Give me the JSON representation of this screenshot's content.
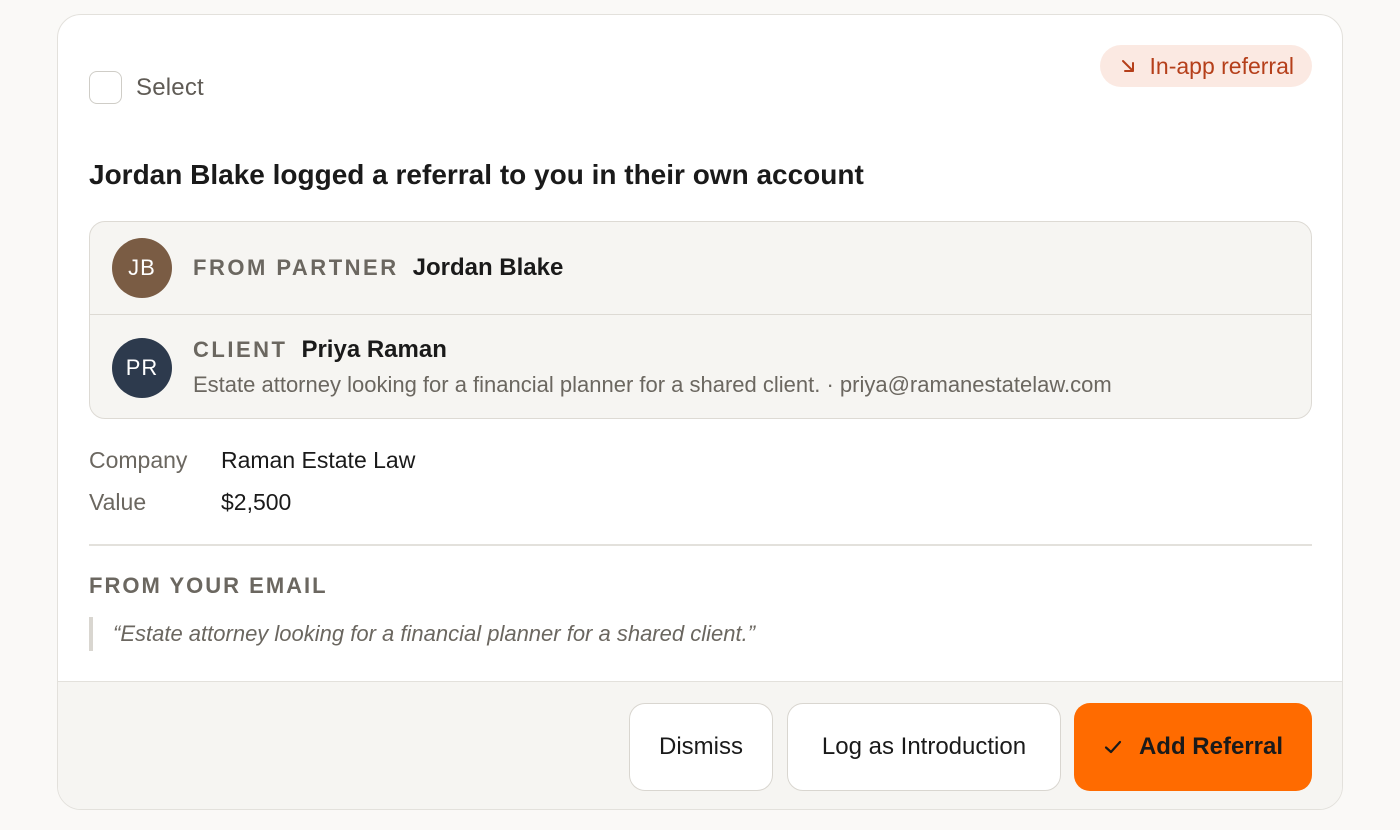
{
  "select": {
    "label": "Select",
    "checked": false
  },
  "badge": {
    "icon": "arrow-down-right-icon",
    "label": "In-app referral",
    "color": "#b53f1a",
    "background": "#fbe9e2"
  },
  "headline": "Jordan Blake logged a referral to you in their own account",
  "partner": {
    "role": "FROM PARTNER",
    "name": "Jordan Blake",
    "initials": "JB",
    "avatar_color": "#7a5c44"
  },
  "client": {
    "role": "CLIENT",
    "name": "Priya Raman",
    "initials": "PR",
    "avatar_color": "#2d3a4d",
    "description": "Estate attorney looking for a financial planner for a shared client. · priya@ramanestatelaw.com"
  },
  "details": [
    {
      "label": "Company",
      "value": "Raman Estate Law"
    },
    {
      "label": "Value",
      "value": "$2,500"
    }
  ],
  "email_section": {
    "heading": "FROM YOUR EMAIL",
    "quote": "“Estate attorney looking for a financial planner for a shared client.”"
  },
  "actions": {
    "dismiss": "Dismiss",
    "log_intro": "Log as Introduction",
    "add_referral": "Add Referral",
    "add_icon": "check-icon",
    "accent": "#ff6b00"
  }
}
